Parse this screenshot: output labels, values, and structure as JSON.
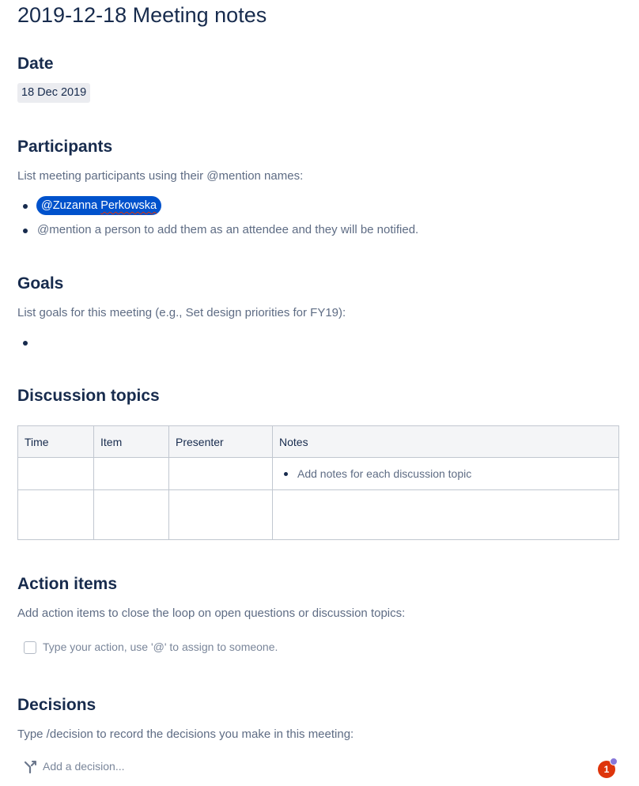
{
  "page": {
    "title": "2019-12-18 Meeting notes"
  },
  "date_section": {
    "heading": "Date",
    "date_value": "18 Dec 2019"
  },
  "participants": {
    "heading": "Participants",
    "instruction": "List meeting participants using their @mention names:",
    "mention_first": "@Zuzanna",
    "mention_last": "Perkowska",
    "hint": "@mention a person to add them as an attendee and they will be notified."
  },
  "goals": {
    "heading": "Goals",
    "instruction": "List goals for this meeting (e.g., Set design priorities for FY19):"
  },
  "discussion": {
    "heading": "Discussion topics",
    "columns": [
      "Time",
      "Item",
      "Presenter",
      "Notes"
    ],
    "notes_placeholder": "Add notes for each discussion topic"
  },
  "action_items": {
    "heading": "Action items",
    "instruction": "Add action items to close the loop on open questions or discussion topics:",
    "task_placeholder": "Type your action, use '@' to assign to someone."
  },
  "decisions": {
    "heading": "Decisions",
    "instruction": "Type /decision to record the decisions you make in this meeting:",
    "decision_placeholder": "Add a decision..."
  },
  "notification": {
    "count": "1"
  },
  "colors": {
    "mention_bg": "#0052cc",
    "heading_text": "#172b4d",
    "badge": "#de350b"
  }
}
